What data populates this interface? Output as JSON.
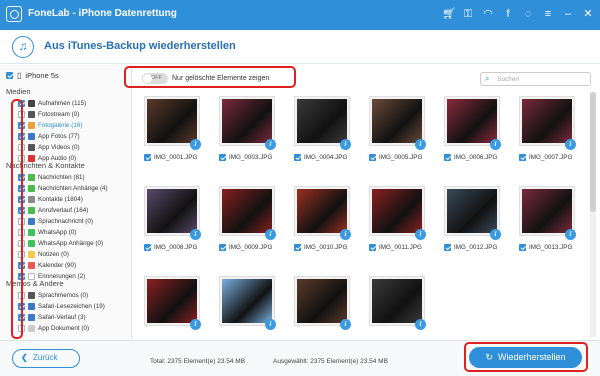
{
  "window": {
    "title": "FoneLab - iPhone Datenrettung"
  },
  "header": {
    "title": "Aus iTunes-Backup wiederherstellen"
  },
  "sidebar": {
    "device": "iPhone 5s",
    "sections": [
      {
        "title": "Medien",
        "items": [
          {
            "label": "Aufnahmen (115)",
            "checked": true,
            "icon": "camera-icon",
            "color": "#444"
          },
          {
            "label": "Fotostream (0)",
            "checked": false,
            "icon": "photostream-icon",
            "color": "#555"
          },
          {
            "label": "Fotogalerie (16)",
            "checked": true,
            "selected": true,
            "icon": "photo-gallery-icon",
            "color": "#e9a23b"
          },
          {
            "label": "App Fotos (77)",
            "checked": true,
            "icon": "app-photos-icon",
            "color": "#3c78c8"
          },
          {
            "label": "App Videos (0)",
            "checked": false,
            "icon": "app-videos-icon",
            "color": "#555"
          },
          {
            "label": "App Audio (0)",
            "checked": false,
            "icon": "app-audio-icon",
            "color": "#d33"
          }
        ]
      },
      {
        "title": "Nachrichten & Kontakte",
        "items": [
          {
            "label": "Nachrichten (81)",
            "checked": true,
            "icon": "messages-icon",
            "color": "#4cbb4c"
          },
          {
            "label": "Nachrichten Anhänge (4)",
            "checked": true,
            "icon": "message-attachments-icon",
            "color": "#4cbb4c"
          },
          {
            "label": "Kontakte (1804)",
            "checked": true,
            "icon": "contacts-icon",
            "color": "#8a8a8a"
          },
          {
            "label": "Anrufverlauf (164)",
            "checked": true,
            "icon": "call-history-icon",
            "color": "#4cbb4c"
          },
          {
            "label": "Sprachnachricht (0)",
            "checked": false,
            "icon": "voicemail-icon",
            "color": "#3c78c8"
          },
          {
            "label": "WhatsApp (0)",
            "checked": false,
            "icon": "whatsapp-icon",
            "color": "#3cc45a"
          },
          {
            "label": "WhatsApp Anhänge (0)",
            "checked": false,
            "icon": "whatsapp-attachments-icon",
            "color": "#3cc45a"
          },
          {
            "label": "Notizen (0)",
            "checked": false,
            "icon": "notes-icon",
            "color": "#f2c94c"
          },
          {
            "label": "Kalender (90)",
            "checked": true,
            "icon": "calendar-icon",
            "color": "#e55"
          },
          {
            "label": "Erinnerungen (2)",
            "checked": true,
            "icon": "reminders-icon",
            "color": "#fff"
          }
        ]
      },
      {
        "title": "Memos & Andere",
        "items": [
          {
            "label": "Sprachmemos (0)",
            "checked": false,
            "icon": "voice-memos-icon",
            "color": "#555"
          },
          {
            "label": "Safari-Lesezeichen (19)",
            "checked": true,
            "icon": "safari-bookmarks-icon",
            "color": "#3c78c8"
          },
          {
            "label": "Safari-Verlauf (3)",
            "checked": true,
            "icon": "safari-history-icon",
            "color": "#3c78c8"
          },
          {
            "label": "App Dokument (0)",
            "checked": false,
            "icon": "app-document-icon",
            "color": "#ccc"
          }
        ]
      }
    ]
  },
  "toolbar": {
    "toggle_label": "OFF",
    "toggle_text": "Nur gelöschte Elemente zeigen",
    "search_placeholder": "Suchen"
  },
  "grid": {
    "items": [
      {
        "name": "IMG_0001.JPG",
        "color": "#5a3a2a"
      },
      {
        "name": "IMG_0003.JPG",
        "color": "#7a2a3a"
      },
      {
        "name": "IMG_0004.JPG",
        "color": "#3a3a3a"
      },
      {
        "name": "IMG_0005.JPG",
        "color": "#6b4a3a"
      },
      {
        "name": "IMG_0006.JPG",
        "color": "#8a2a3a"
      },
      {
        "name": "IMG_0007.JPG",
        "color": "#7a2a3a"
      },
      {
        "name": "IMG_0008.JPG",
        "color": "#5a4a6a"
      },
      {
        "name": "IMG_0009.JPG",
        "color": "#8a2020"
      },
      {
        "name": "IMG_0010.JPG",
        "color": "#9a3020"
      },
      {
        "name": "IMG_0011.JPG",
        "color": "#8a2020"
      },
      {
        "name": "IMG_0012.JPG",
        "color": "#3a4a5a"
      },
      {
        "name": "IMG_0013.JPG",
        "color": "#7a2a3a"
      },
      {
        "name": "",
        "color": "#8a2020"
      },
      {
        "name": "",
        "color": "#7ab0e0"
      },
      {
        "name": "",
        "color": "#5a3a2a"
      },
      {
        "name": "",
        "color": "#3a3a3a"
      }
    ]
  },
  "footer": {
    "back_label": "Zurück",
    "total": "Total: 2375 Element(e) 23.54 MB",
    "selected": "Ausgewählt: 2375 Element(e) 23.54 MB",
    "restore_label": "Wiederherstellen"
  },
  "colors": {
    "accent": "#2f8fd8",
    "highlight": "#e02020"
  }
}
